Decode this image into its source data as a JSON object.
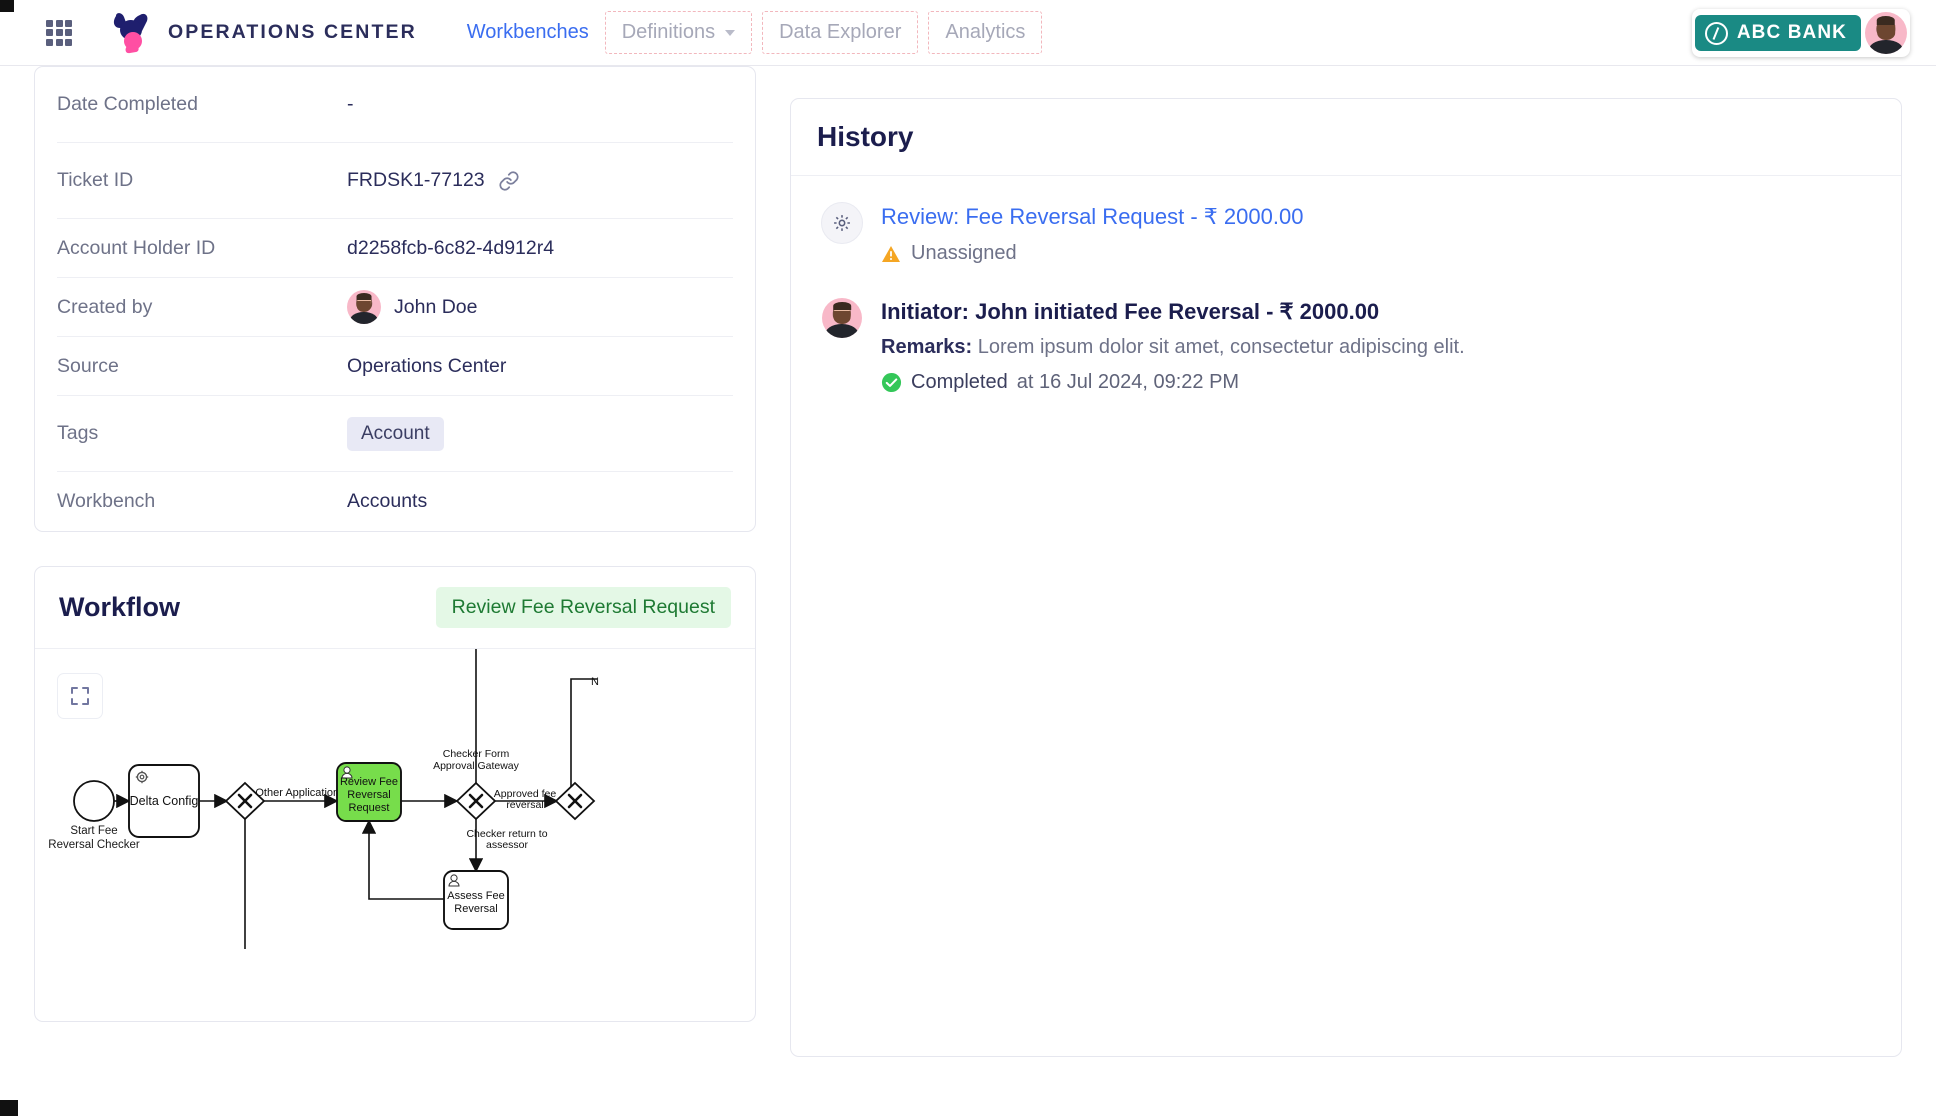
{
  "header": {
    "grid_icon": "apps-grid-icon",
    "brand": "OPERATIONS CENTER",
    "nav": [
      {
        "label": "Workbenches",
        "state": "active"
      },
      {
        "label": "Definitions",
        "state": "disabled",
        "has_caret": true
      },
      {
        "label": "Data Explorer",
        "state": "disabled"
      },
      {
        "label": "Analytics",
        "state": "disabled"
      }
    ],
    "bank": {
      "name": "ABC BANK",
      "color": "#1a8a84"
    },
    "avatar_name": "user-avatar"
  },
  "details": {
    "rows": [
      {
        "label": "Date Completed",
        "value": "-",
        "type": "text"
      },
      {
        "label": "Ticket ID",
        "value": "FRDSK1-77123",
        "type": "link-icon"
      },
      {
        "label": "Account Holder ID",
        "value": "d2258fcb-6c82-4d912r4",
        "type": "text"
      },
      {
        "label": "Created by",
        "value": "John Doe",
        "type": "avatar"
      },
      {
        "label": "Source",
        "value": "Operations Center",
        "type": "text"
      },
      {
        "label": "Tags",
        "value": "Account",
        "type": "chip"
      },
      {
        "label": "Workbench",
        "value": "Accounts",
        "type": "text"
      }
    ]
  },
  "workflow": {
    "title": "Workflow",
    "badge": "Review Fee Reversal Request",
    "expand_icon": "expand-arrows-icon",
    "diagram": {
      "start_event": "Start Fee\nReversal Checker",
      "start_label_line1": "Start Fee",
      "start_label_line2": "Reversal Checker",
      "tasks": [
        {
          "id": "delta",
          "label": "Delta Config",
          "icon": "gear-icon",
          "highlight": false
        },
        {
          "id": "review",
          "label": "Review Fee\nReversal\nRequest",
          "icon": "user-icon",
          "highlight": true
        },
        {
          "id": "assess",
          "label": "Assess Fee\nReversal",
          "icon": "user-icon",
          "highlight": false
        }
      ],
      "review_l1": "Review Fee",
      "review_l2": "Reversal",
      "review_l3": "Request",
      "assess_l1": "Assess Fee",
      "assess_l2": "Reversal",
      "gateway_label_1": "Checker Form",
      "gateway_label_2": "Approval Gateway",
      "edge_other_apps": "Other Applications",
      "edge_approved_1": "Approved fee",
      "edge_approved_2": "reversal",
      "edge_return_1": "Checker return to",
      "edge_return_2": "assessor",
      "edge_n": "N"
    }
  },
  "history": {
    "title": "History",
    "entries": [
      {
        "icon": "gear-icon",
        "title": "Review: Fee Reversal Request - ₹ 2000.00",
        "title_style": "link",
        "status": "Unassigned",
        "status_icon": "warning-triangle-icon"
      },
      {
        "icon": "avatar",
        "title": "Initiator: John initiated Fee Reversal  - ₹ 2000.00",
        "title_style": "strong",
        "remarks_label": "Remarks:",
        "remarks_text": "Lorem ipsum dolor sit amet, consectetur adipiscing elit.",
        "completed_label": "Completed",
        "completed_at": "at 16 Jul 2024, 09:22 PM",
        "completed_icon": "check-circle-icon"
      }
    ]
  },
  "colors": {
    "accent_blue": "#3a6df0",
    "navy": "#1b1d4d",
    "teal": "#1a8a84",
    "green_task": "#77dd4b",
    "badge_green_bg": "#e4f8e6",
    "badge_green_text": "#1e7a33",
    "warning_orange": "#f5a623",
    "success_green": "#34c759"
  }
}
